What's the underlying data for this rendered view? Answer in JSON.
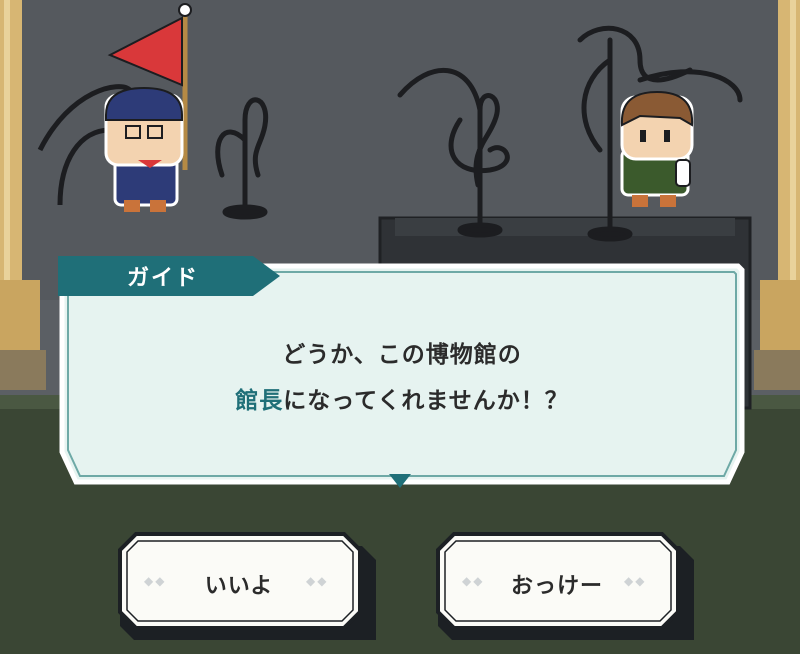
{
  "dialog": {
    "speaker": "ガイド",
    "line1": "どうか、この博物館の",
    "line2_highlight": "館長",
    "line2_rest": "になってくれませんか！？"
  },
  "choices": {
    "yes_label": "いいよ",
    "ok_label": "おっけー"
  },
  "colors": {
    "accent_teal": "#1f6f78",
    "dialog_bg": "#e6f3f0",
    "wall": "#5a5e63",
    "floor": "#3d4a36"
  },
  "icons": {
    "speaker_flag": "red-flag-icon",
    "continue": "triangle-down-icon",
    "button_decoration": "diamond-icon"
  }
}
